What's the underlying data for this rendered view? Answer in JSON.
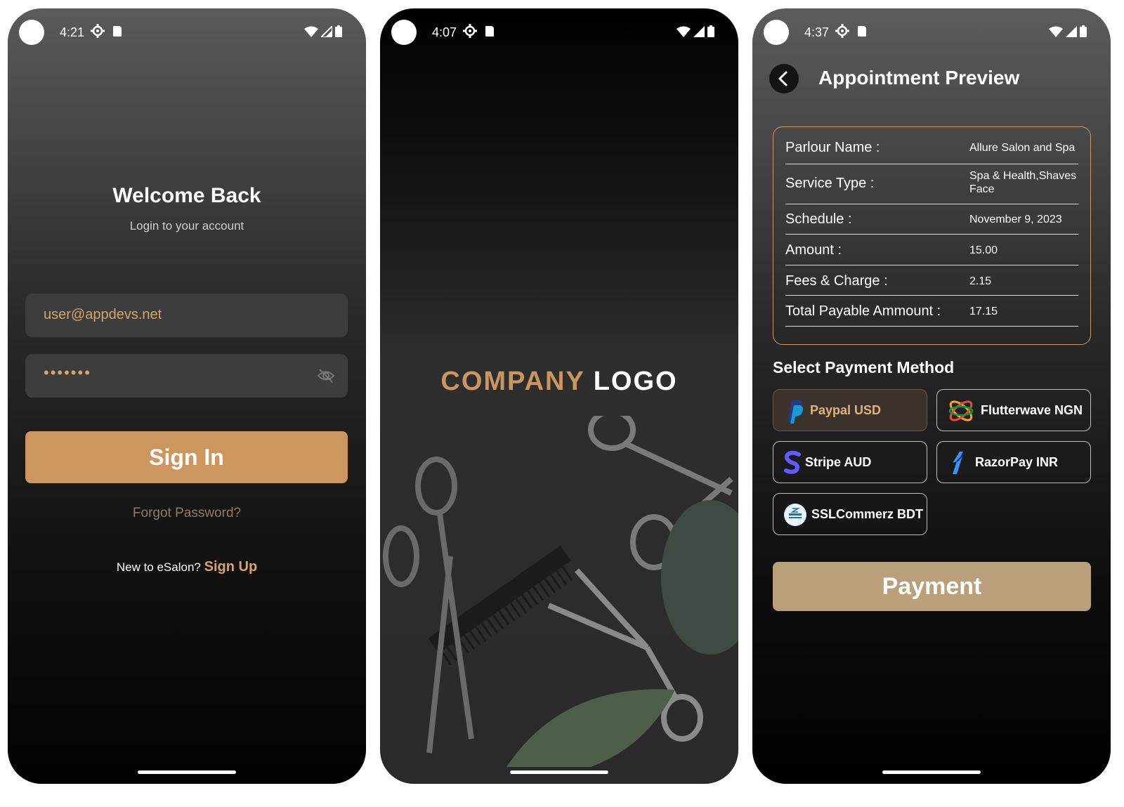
{
  "colors": {
    "accent": "#cd965e",
    "card_border": "#c79a63",
    "payment_button": "#b9a07b"
  },
  "screens": [
    {
      "status": {
        "time": "4:21"
      },
      "login": {
        "title": "Welcome Back",
        "subtitle": "Login to your account",
        "email_value": "user@appdevs.net",
        "password_value": "•••••••",
        "sign_in_label": "Sign In",
        "forgot_label": "Forgot Password?",
        "new_user_text": "New to eSalon?",
        "sign_up_label": "Sign Up"
      }
    },
    {
      "status": {
        "time": "4:07"
      },
      "splash": {
        "logo_word1": "COMPANY",
        "logo_word2": "LOGO"
      }
    },
    {
      "status": {
        "time": "4:37"
      },
      "preview": {
        "title": "Appointment Preview",
        "rows": [
          {
            "label": "Parlour Name :",
            "value": "Allure Salon and Spa"
          },
          {
            "label": "Service Type :",
            "value": "Spa & Health,Shaves Face"
          },
          {
            "label": "Schedule :",
            "value": "November 9, 2023"
          },
          {
            "label": "Amount :",
            "value": "15.00"
          },
          {
            "label": "Fees & Charge :",
            "value": "2.15"
          },
          {
            "label": "Total Payable Ammount :",
            "value": "17.15"
          }
        ],
        "payment_section_title": "Select Payment Method",
        "methods": [
          {
            "label": "Paypal USD",
            "selected": true
          },
          {
            "label": "Flutterwave NGN"
          },
          {
            "label": "Stripe AUD"
          },
          {
            "label": "RazorPay INR"
          },
          {
            "label": "SSLCommerz BDT"
          }
        ],
        "payment_label": "Payment"
      }
    }
  ]
}
